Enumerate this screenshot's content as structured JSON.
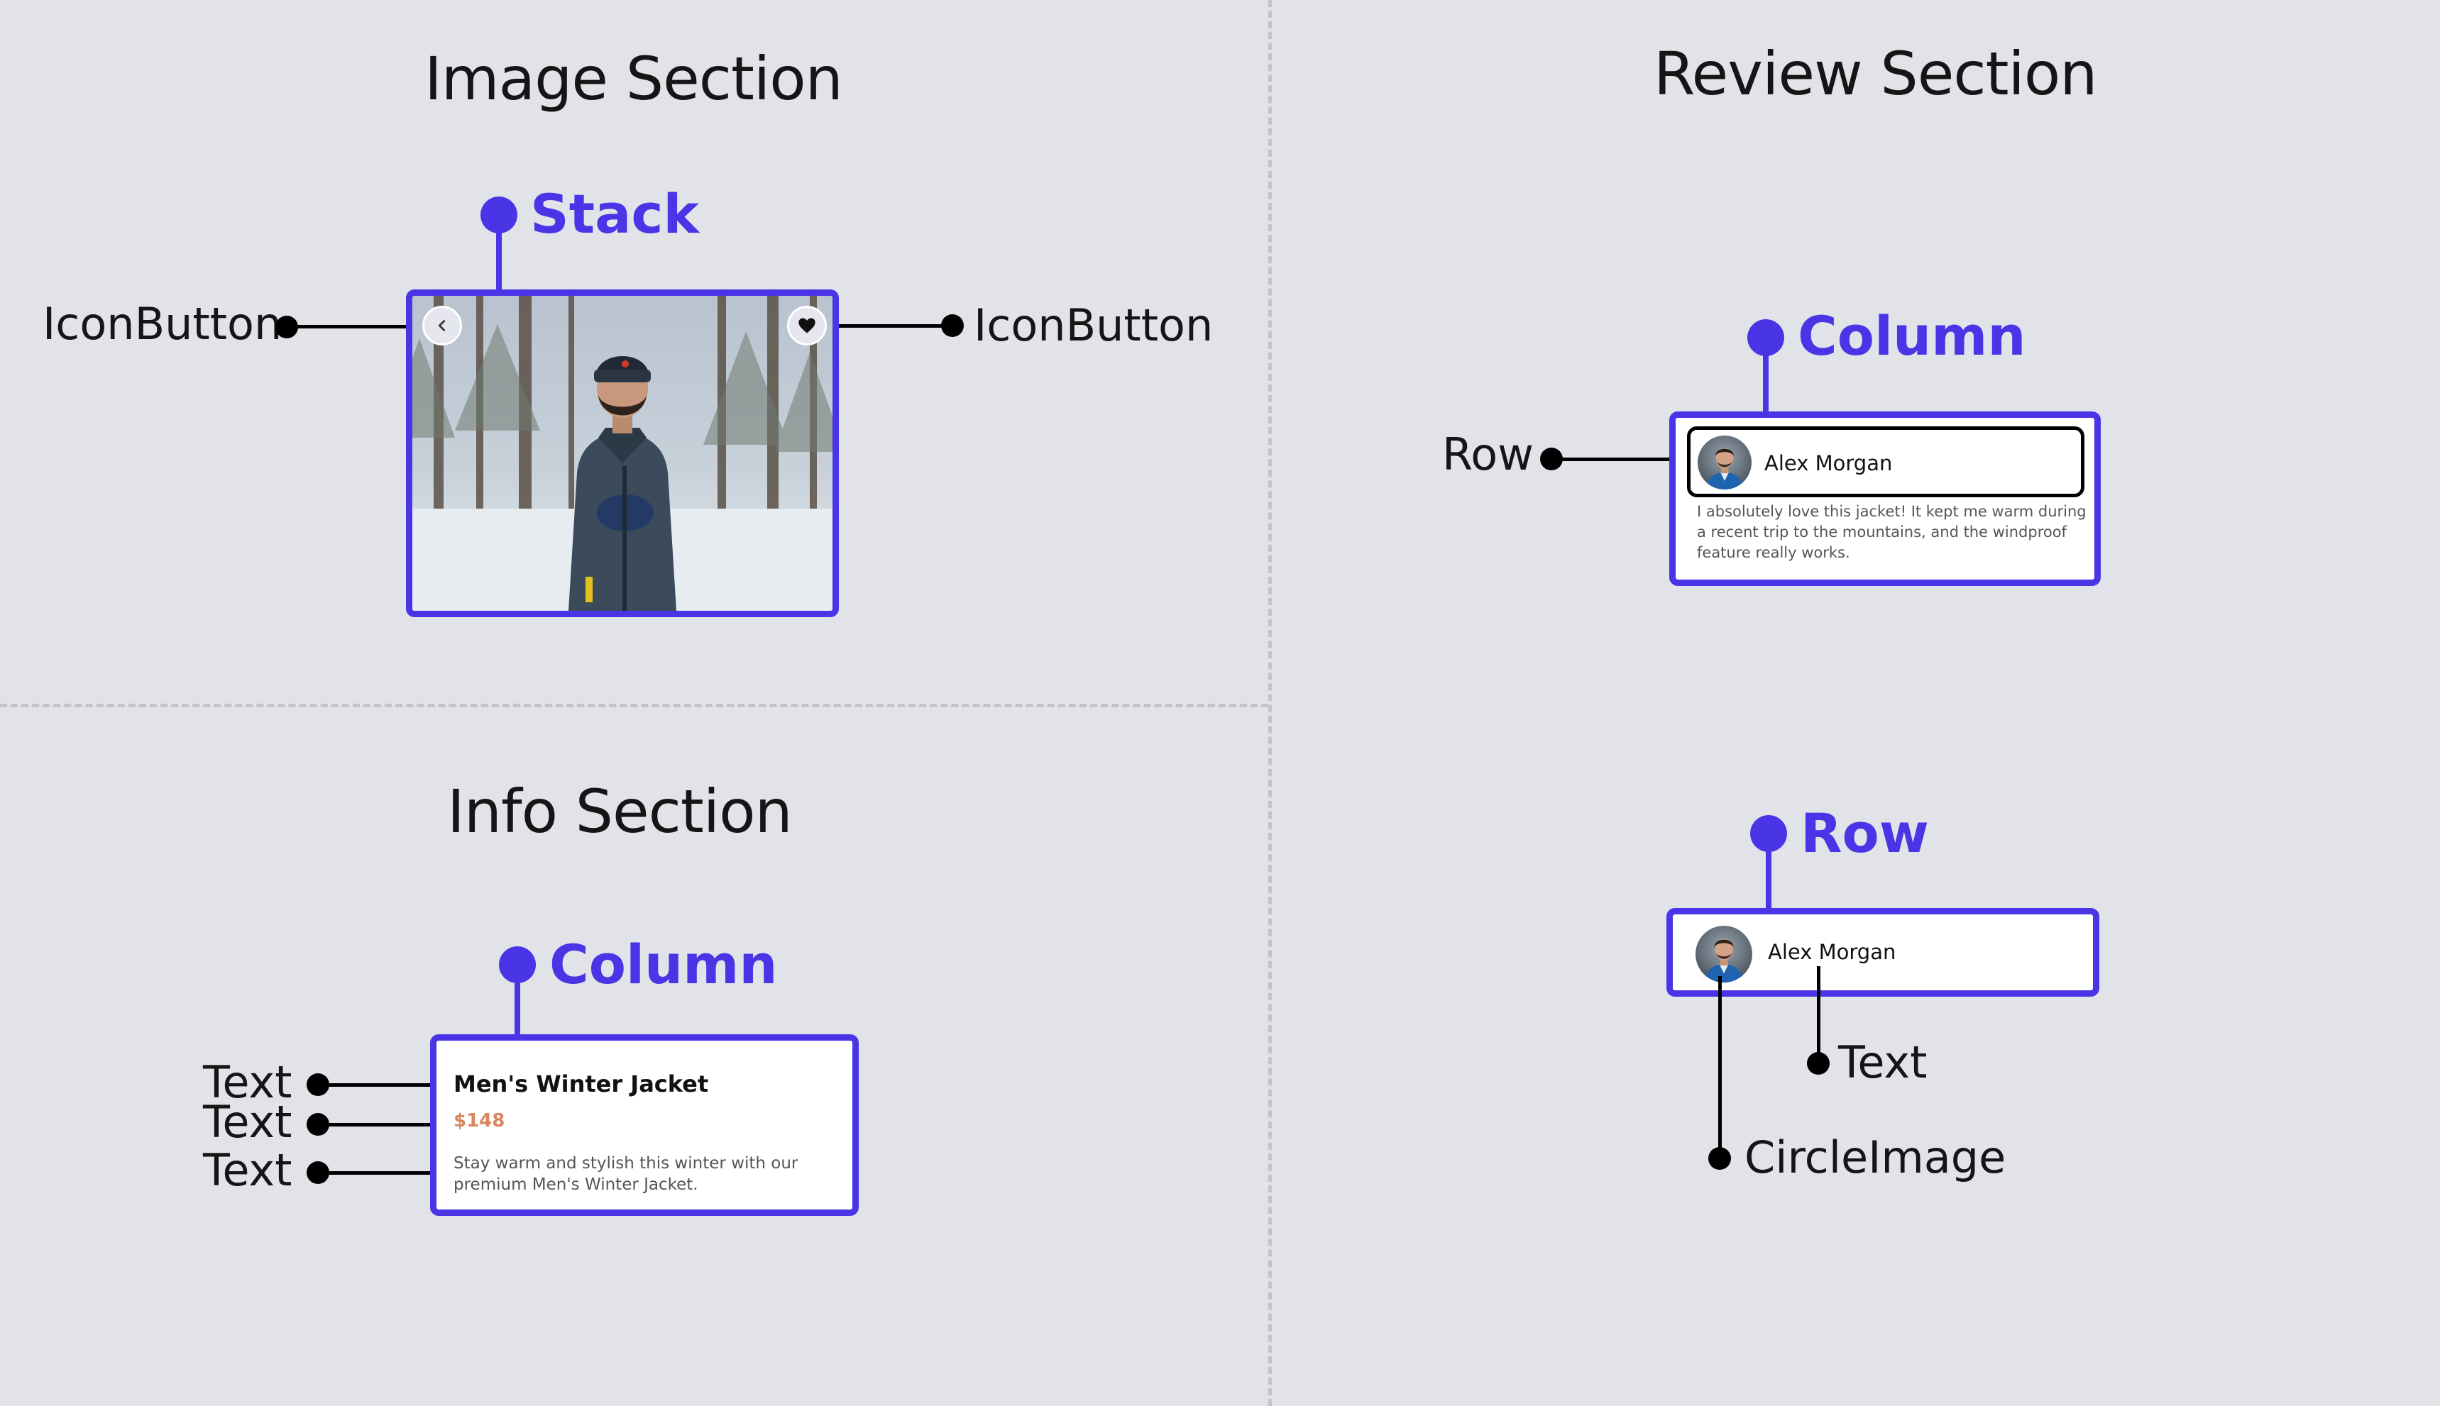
{
  "image_section": {
    "title": "Image Section",
    "container_label": "Stack",
    "left_label": "IconButton",
    "right_label": "IconButton",
    "back_icon": "chevron-left-icon",
    "favorite_icon": "heart-icon"
  },
  "info_section": {
    "title": "Info Section",
    "container_label": "Column",
    "text_labels": [
      "Text",
      "Text",
      "Text"
    ],
    "product_name": "Men's Winter Jacket",
    "price": "$148",
    "description": "Stay warm and stylish this winter with our premium Men's Winter Jacket."
  },
  "review_section": {
    "title": "Review Section",
    "container_label": "Column",
    "row_label": "Row",
    "reviewer_name": "Alex Morgan",
    "review_text": "I absolutely love this jacket! It kept me warm during a recent trip to the mountains, and the windproof feature really works."
  },
  "row_detail": {
    "container_label": "Row",
    "reviewer_name": "Alex Morgan",
    "text_label": "Text",
    "image_label": "CircleImage"
  },
  "colors": {
    "accent": "#4a35e6",
    "price": "#d9865f",
    "background": "#e2e3e9"
  }
}
